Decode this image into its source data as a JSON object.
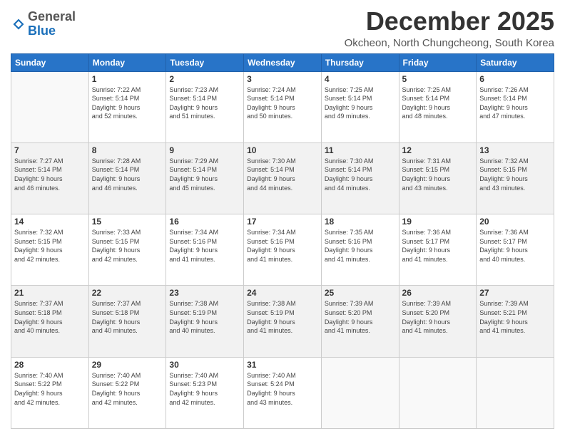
{
  "logo": {
    "general": "General",
    "blue": "Blue"
  },
  "title": "December 2025",
  "location": "Okcheon, North Chungcheong, South Korea",
  "days_header": [
    "Sunday",
    "Monday",
    "Tuesday",
    "Wednesday",
    "Thursday",
    "Friday",
    "Saturday"
  ],
  "weeks": [
    [
      {
        "day": "",
        "info": ""
      },
      {
        "day": "1",
        "info": "Sunrise: 7:22 AM\nSunset: 5:14 PM\nDaylight: 9 hours\nand 52 minutes."
      },
      {
        "day": "2",
        "info": "Sunrise: 7:23 AM\nSunset: 5:14 PM\nDaylight: 9 hours\nand 51 minutes."
      },
      {
        "day": "3",
        "info": "Sunrise: 7:24 AM\nSunset: 5:14 PM\nDaylight: 9 hours\nand 50 minutes."
      },
      {
        "day": "4",
        "info": "Sunrise: 7:25 AM\nSunset: 5:14 PM\nDaylight: 9 hours\nand 49 minutes."
      },
      {
        "day": "5",
        "info": "Sunrise: 7:25 AM\nSunset: 5:14 PM\nDaylight: 9 hours\nand 48 minutes."
      },
      {
        "day": "6",
        "info": "Sunrise: 7:26 AM\nSunset: 5:14 PM\nDaylight: 9 hours\nand 47 minutes."
      }
    ],
    [
      {
        "day": "7",
        "info": "Sunrise: 7:27 AM\nSunset: 5:14 PM\nDaylight: 9 hours\nand 46 minutes."
      },
      {
        "day": "8",
        "info": "Sunrise: 7:28 AM\nSunset: 5:14 PM\nDaylight: 9 hours\nand 46 minutes."
      },
      {
        "day": "9",
        "info": "Sunrise: 7:29 AM\nSunset: 5:14 PM\nDaylight: 9 hours\nand 45 minutes."
      },
      {
        "day": "10",
        "info": "Sunrise: 7:30 AM\nSunset: 5:14 PM\nDaylight: 9 hours\nand 44 minutes."
      },
      {
        "day": "11",
        "info": "Sunrise: 7:30 AM\nSunset: 5:14 PM\nDaylight: 9 hours\nand 44 minutes."
      },
      {
        "day": "12",
        "info": "Sunrise: 7:31 AM\nSunset: 5:15 PM\nDaylight: 9 hours\nand 43 minutes."
      },
      {
        "day": "13",
        "info": "Sunrise: 7:32 AM\nSunset: 5:15 PM\nDaylight: 9 hours\nand 43 minutes."
      }
    ],
    [
      {
        "day": "14",
        "info": "Sunrise: 7:32 AM\nSunset: 5:15 PM\nDaylight: 9 hours\nand 42 minutes."
      },
      {
        "day": "15",
        "info": "Sunrise: 7:33 AM\nSunset: 5:15 PM\nDaylight: 9 hours\nand 42 minutes."
      },
      {
        "day": "16",
        "info": "Sunrise: 7:34 AM\nSunset: 5:16 PM\nDaylight: 9 hours\nand 41 minutes."
      },
      {
        "day": "17",
        "info": "Sunrise: 7:34 AM\nSunset: 5:16 PM\nDaylight: 9 hours\nand 41 minutes."
      },
      {
        "day": "18",
        "info": "Sunrise: 7:35 AM\nSunset: 5:16 PM\nDaylight: 9 hours\nand 41 minutes."
      },
      {
        "day": "19",
        "info": "Sunrise: 7:36 AM\nSunset: 5:17 PM\nDaylight: 9 hours\nand 41 minutes."
      },
      {
        "day": "20",
        "info": "Sunrise: 7:36 AM\nSunset: 5:17 PM\nDaylight: 9 hours\nand 40 minutes."
      }
    ],
    [
      {
        "day": "21",
        "info": "Sunrise: 7:37 AM\nSunset: 5:18 PM\nDaylight: 9 hours\nand 40 minutes."
      },
      {
        "day": "22",
        "info": "Sunrise: 7:37 AM\nSunset: 5:18 PM\nDaylight: 9 hours\nand 40 minutes."
      },
      {
        "day": "23",
        "info": "Sunrise: 7:38 AM\nSunset: 5:19 PM\nDaylight: 9 hours\nand 40 minutes."
      },
      {
        "day": "24",
        "info": "Sunrise: 7:38 AM\nSunset: 5:19 PM\nDaylight: 9 hours\nand 41 minutes."
      },
      {
        "day": "25",
        "info": "Sunrise: 7:39 AM\nSunset: 5:20 PM\nDaylight: 9 hours\nand 41 minutes."
      },
      {
        "day": "26",
        "info": "Sunrise: 7:39 AM\nSunset: 5:20 PM\nDaylight: 9 hours\nand 41 minutes."
      },
      {
        "day": "27",
        "info": "Sunrise: 7:39 AM\nSunset: 5:21 PM\nDaylight: 9 hours\nand 41 minutes."
      }
    ],
    [
      {
        "day": "28",
        "info": "Sunrise: 7:40 AM\nSunset: 5:22 PM\nDaylight: 9 hours\nand 42 minutes."
      },
      {
        "day": "29",
        "info": "Sunrise: 7:40 AM\nSunset: 5:22 PM\nDaylight: 9 hours\nand 42 minutes."
      },
      {
        "day": "30",
        "info": "Sunrise: 7:40 AM\nSunset: 5:23 PM\nDaylight: 9 hours\nand 42 minutes."
      },
      {
        "day": "31",
        "info": "Sunrise: 7:40 AM\nSunset: 5:24 PM\nDaylight: 9 hours\nand 43 minutes."
      },
      {
        "day": "",
        "info": ""
      },
      {
        "day": "",
        "info": ""
      },
      {
        "day": "",
        "info": ""
      }
    ]
  ]
}
